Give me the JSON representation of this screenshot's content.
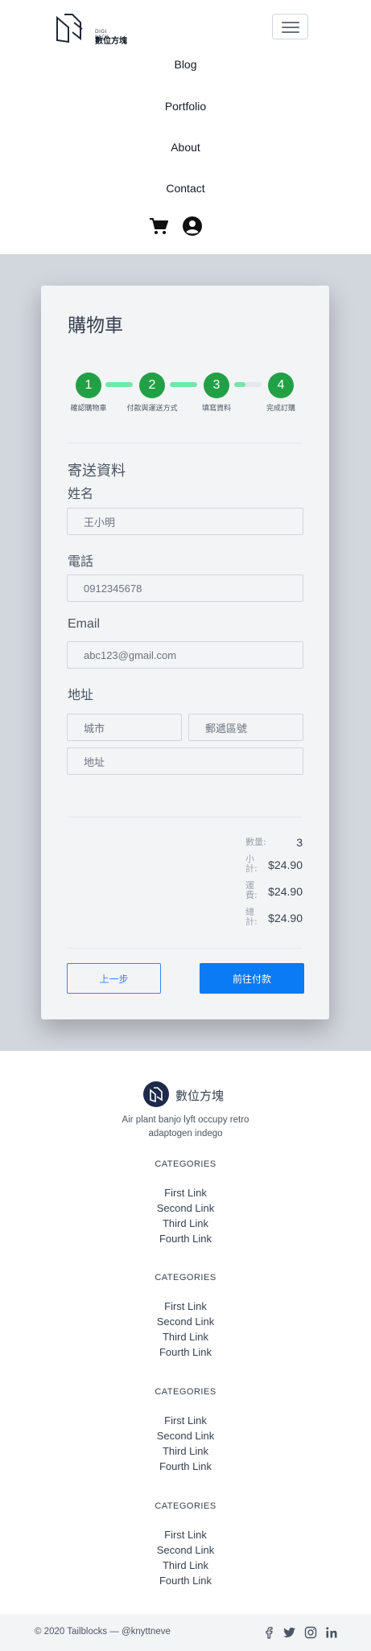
{
  "header": {
    "logo_brand": "DIGI PACK",
    "logo_name": "數位方塊",
    "nav": [
      "Blog",
      "Portfolio",
      "About",
      "Contact"
    ],
    "cart_icon": "cart-icon",
    "user_icon": "user-circle-icon",
    "menu_icon": "hamburger-icon"
  },
  "checkout": {
    "title": "購物車",
    "steps": [
      {
        "number": "1",
        "label": "確認購物車"
      },
      {
        "number": "2",
        "label": "付款與運送方式"
      },
      {
        "number": "3",
        "label": "填寫資料"
      },
      {
        "number": "4",
        "label": "完成訂購"
      }
    ],
    "progress": [
      1,
      1,
      0.4
    ],
    "section_title": "寄送資料",
    "fields": {
      "name_label": "姓名",
      "name_value": "王小明",
      "phone_label": "電話",
      "phone_value": "0912345678",
      "email_label": "Email",
      "email_value": "abc123@gmail.com",
      "address_label": "地址",
      "city_placeholder": "城市",
      "zip_placeholder": "郵遞區號",
      "address_placeholder": "地址"
    },
    "summary": {
      "qty_label": "數量:",
      "qty_value": "3",
      "subtotal_label": "小計:",
      "subtotal_value": "$24.90",
      "shipping_label": "運費:",
      "shipping_value": "$24.90",
      "total_label": "總計:",
      "total_value": "$24.90"
    },
    "back_button": "上一步",
    "pay_button": "前往付款"
  },
  "colors": {
    "step_green": "#22a045",
    "progress_green": "#6ee7a8",
    "primary_blue": "#0a7af5",
    "background_gray": "#d2d6dd"
  },
  "footer": {
    "name": "數位方塊",
    "description": "Air plant banjo lyft occupy retro adaptogen indego",
    "categories": [
      {
        "title": "CATEGORIES",
        "links": [
          "First Link",
          "Second Link",
          "Third Link",
          "Fourth Link"
        ]
      },
      {
        "title": "CATEGORIES",
        "links": [
          "First Link",
          "Second Link",
          "Third Link",
          "Fourth Link"
        ]
      },
      {
        "title": "CATEGORIES",
        "links": [
          "First Link",
          "Second Link",
          "Third Link",
          "Fourth Link"
        ]
      },
      {
        "title": "CATEGORIES",
        "links": [
          "First Link",
          "Second Link",
          "Third Link",
          "Fourth Link"
        ]
      }
    ],
    "copyright": "© 2020 Tailblocks — @knyttneve",
    "social_icons": [
      "facebook-icon",
      "twitter-icon",
      "instagram-icon",
      "linkedin-icon"
    ]
  }
}
